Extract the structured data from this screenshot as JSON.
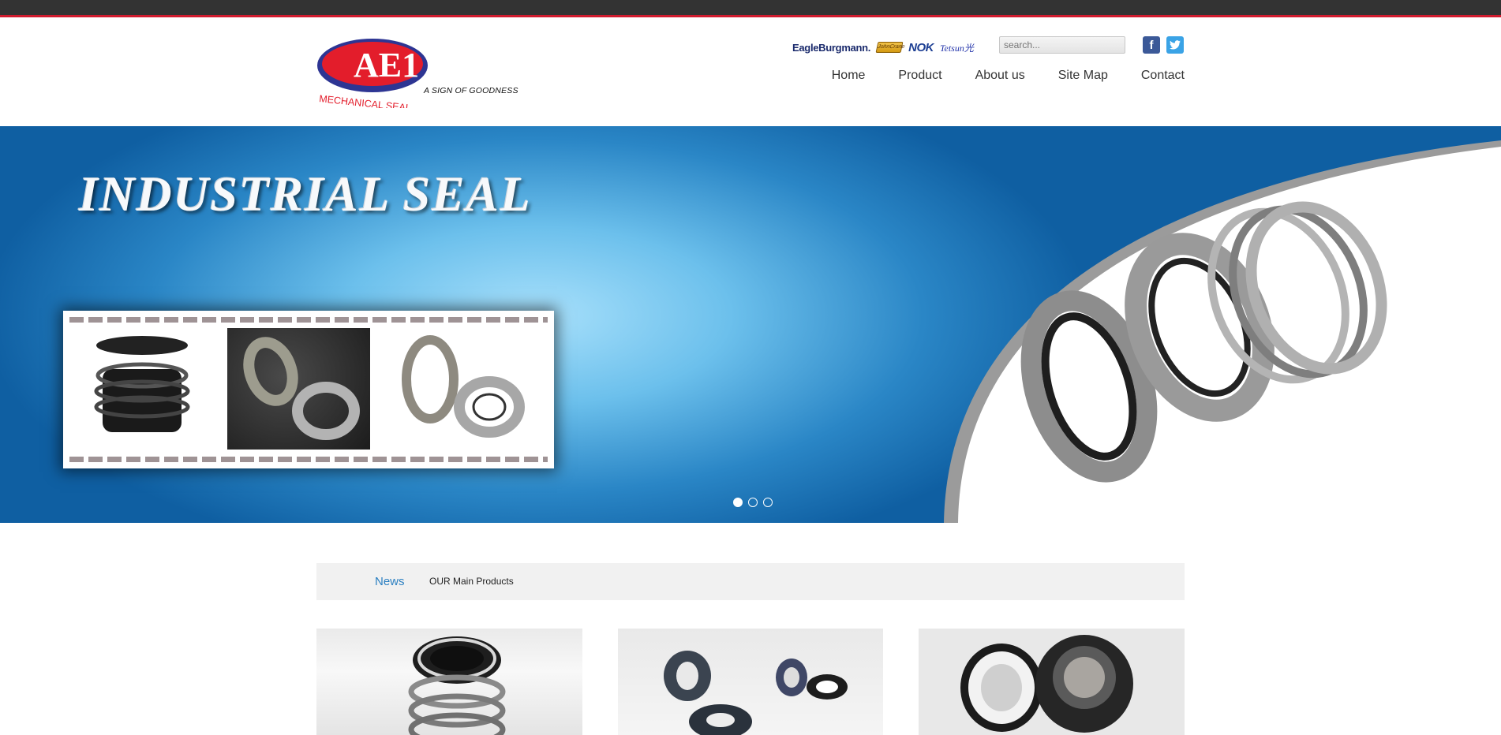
{
  "header": {
    "logo_text": "AE1",
    "logo_subtext": "MECHANICAL SEAL",
    "tagline": "A SIGN OF GOODNESS",
    "brands": {
      "eagleburgmann": "EagleBurgmann.",
      "johncrane": "JohnCrane",
      "nok": "NOK",
      "tb": "Tetsun光"
    },
    "search_placeholder": "search...",
    "facebook_glyph": "f",
    "twitter_glyph": "t"
  },
  "nav": {
    "items": [
      "Home",
      "Product",
      "About us",
      "Site Map",
      "Contact"
    ]
  },
  "hero": {
    "title": "INDUSTRIAL SEAL",
    "slide_count": 3,
    "active_slide": 1
  },
  "tabs": {
    "news": "News",
    "main_products": "OUR Main Products"
  },
  "colors": {
    "topbar": "#333333",
    "accent_red": "#d01b2e",
    "logo_blue": "#2d3593",
    "link_blue": "#2a7fc1"
  }
}
